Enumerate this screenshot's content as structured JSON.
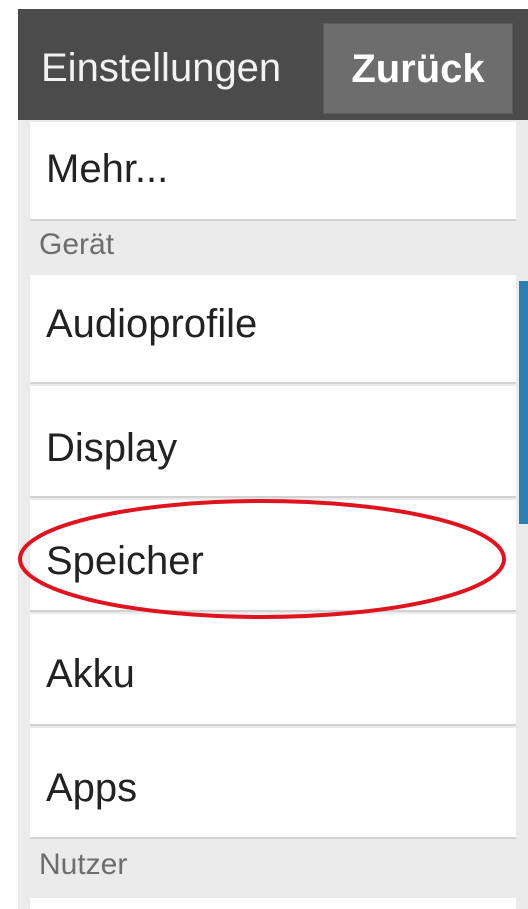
{
  "header": {
    "title": "Einstellungen",
    "back_label": "Zurück"
  },
  "items_top": [
    {
      "label": "Mehr..."
    }
  ],
  "sections": [
    {
      "title": "Gerät",
      "items": [
        {
          "label": "Audioprofile"
        },
        {
          "label": "Display"
        },
        {
          "label": "Speicher",
          "highlighted": true
        },
        {
          "label": "Akku"
        },
        {
          "label": "Apps"
        }
      ]
    },
    {
      "title": "Nutzer",
      "items": []
    }
  ],
  "colors": {
    "header_bg": "#4b4b4b",
    "back_button_bg": "#6d6d6d",
    "page_bg": "#ebebeb",
    "card_bg": "#ffffff",
    "scroll_indicator": "#2e7fb0",
    "annotation": "#e0141e"
  }
}
